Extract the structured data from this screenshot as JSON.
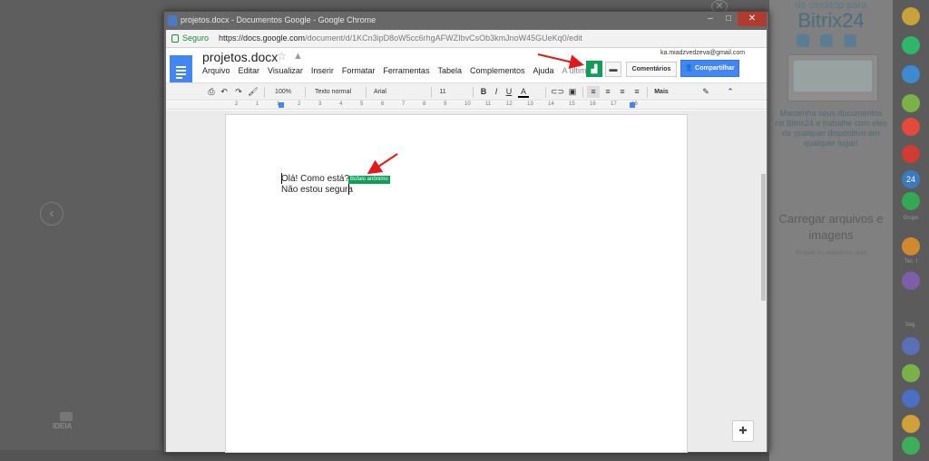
{
  "chrome": {
    "window_title": "projetos.docx - Documentos Google - Google Chrome",
    "secure_label": "Seguro",
    "url_host": "https://docs.google.com",
    "url_path": "/document/d/1KCn3ipD8oW5cc6rhgAFWZIbvCsOb3kmJnoW45GUeKq0/edit",
    "min_label": "–",
    "max_label": "□",
    "close_label": "✕"
  },
  "docs": {
    "title": "projetos.docx",
    "account_email": "ka.miadzvedzeva@gmail.com",
    "menu": [
      "Arquivo",
      "Editar",
      "Visualizar",
      "Inserir",
      "Formatar",
      "Ferramentas",
      "Tabela",
      "Complementos",
      "Ajuda"
    ],
    "last_edit": "A última e",
    "comments_label": "Comentários",
    "share_label": "Compartilhar"
  },
  "toolbar": {
    "zoom": "100%",
    "style": "Texto normal",
    "font": "Arial",
    "size": "11",
    "more": "Mais",
    "bold": "B",
    "italic": "I",
    "underline": "U",
    "textcolor": "A"
  },
  "ruler": [
    "2",
    "1",
    "1",
    "2",
    "3",
    "4",
    "5",
    "6",
    "7",
    "8",
    "9",
    "10",
    "11",
    "12",
    "13",
    "14",
    "15",
    "16",
    "17",
    "18"
  ],
  "document": {
    "line1": "Olá! Como está?",
    "line2": "Não estou segura",
    "collaborator_badge": "Búfalo anônimo"
  },
  "bitrix": {
    "top": "de desktop para",
    "title": "Bitrix24",
    "promo": "Mantenha seus documentos no Bitrix24 e trabalhe com eles de qualquer dispositivo em qualquer lugar!",
    "upload": "Carregar arquivos e imagens",
    "upload_sub": "Arraste ou selecione aqui"
  },
  "rail": {
    "badge_count": "24",
    "label_grupo": "Grupo",
    "label_tec": "Tec. I",
    "label_seg": "Seg."
  },
  "background": {
    "idea_label": "IDEIA",
    "nav_prev": "‹",
    "nav_next": "›",
    "overlay_close": "✕"
  }
}
